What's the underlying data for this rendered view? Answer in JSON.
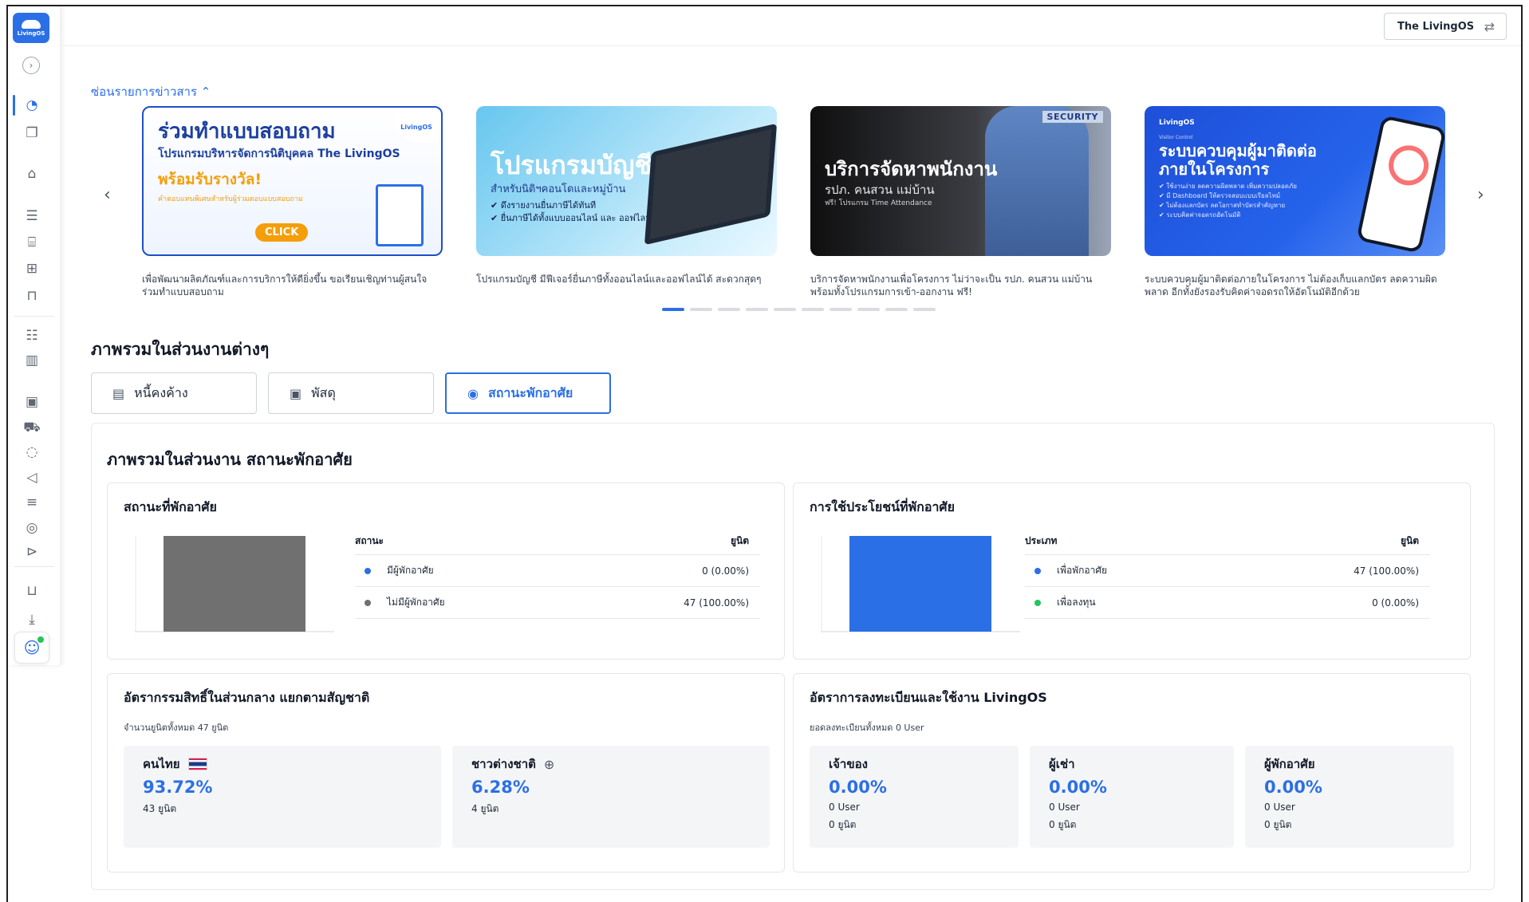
{
  "logo": {
    "text": "LivingOS"
  },
  "sidebar": {
    "expand_glyph": "›",
    "icons": [
      {
        "name": "dashboard-icon",
        "glyph": "◔",
        "active": true
      },
      {
        "name": "documents-icon",
        "glyph": "❐"
      },
      {
        "name": "home-icon",
        "glyph": "⌂"
      },
      {
        "name": "database-icon",
        "glyph": "☰"
      },
      {
        "name": "bank-icon",
        "glyph": "⌸"
      },
      {
        "name": "grid-icon",
        "glyph": "⊞"
      },
      {
        "name": "chair-icon",
        "glyph": "⊓"
      },
      {
        "name": "chat-board-icon",
        "glyph": "☷"
      },
      {
        "name": "building-icon",
        "glyph": "▥"
      },
      {
        "name": "parcel-icon",
        "glyph": "▣"
      },
      {
        "name": "truck-icon",
        "glyph": "⛟"
      },
      {
        "name": "message-icon",
        "glyph": "◌"
      },
      {
        "name": "megaphone-icon",
        "glyph": "◁"
      },
      {
        "name": "facility-icon",
        "glyph": "≡"
      },
      {
        "name": "support-icon",
        "glyph": "◎"
      },
      {
        "name": "cctv-icon",
        "glyph": "⊳"
      },
      {
        "name": "cart-icon",
        "glyph": "⊔"
      },
      {
        "name": "download-icon",
        "glyph": "⤓"
      }
    ],
    "bot_glyph": "☺"
  },
  "topbar": {
    "project_name": "The LivingOS",
    "switch_glyph": "⇄"
  },
  "news": {
    "toggle_label": "ซ่อนรายการข่าวสาร ⌃",
    "prev_glyph": "‹",
    "next_glyph": "›",
    "banners": [
      {
        "title": "ร่วมทำแบบสอบถาม",
        "subtitle": "โปรแกรมบริหารจัดการนิติบุคคล The LivingOS",
        "highlight": "พร้อมรับรางวัล!",
        "note": "คำตอบแทนพิเศษสำหรับผู้ร่วมตอบแบบสอบถาม",
        "button": "CLICK",
        "badge": "LivingOS",
        "caption": "เพื่อพัฒนาผลิตภัณฑ์และการบริการให้ดียิ่งขึ้น ขอเรียนเชิญท่านผู้สนใจ ร่วมทำแบบสอบถาม"
      },
      {
        "title": "โปรแกรมบัญชี",
        "subtitle": "สำหรับนิติฯคอนโดและหมู่บ้าน",
        "bullets": "✔ ดึงรายงานยื่นภาษีได้ทันที\n✔ ยื่นภาษีได้ทั้งแบบออนไลน์ และ ออฟไลน์",
        "caption": "โปรแกรมบัญชี มีฟีเจอร์ยื่นภาษีทั้งออนไลน์และออฟไลน์ได้ สะดวกสุดๆ"
      },
      {
        "tag": "SECURITY",
        "title": "บริการจัดหาพนักงาน",
        "subtitle": "รปภ. คนสวน แม่บ้าน",
        "note": "ฟรี! โปรแกรม Time Attendance",
        "caption": "บริการจัดหาพนักงานเพื่อโครงการ ไม่ว่าจะเป็น รปภ. คนสวน แม่บ้าน พร้อมทั้งโปรแกรมการเข้า-ออกงาน ฟรี!"
      },
      {
        "brand": "LivingOS",
        "eyebrow": "Visitor Control",
        "title": "ระบบควบคุมผู้มาติดต่อ ภายในโครงการ",
        "bullets": "✔ ใช้งานง่าย ลดความผิดพลาด เพิ่มความปลอดภัย\n✔ มี Dashboard ให้ตรวจสอบแบบเรียลไทม์\n✔ ไม่ต้องแลกบัตร ลดโอกาสทำบัตรสำคัญหาย\n✔ ระบบคิดค่าจอดรถอัตโนมัติ",
        "caption": "ระบบควบคุมผู้มาติดต่อภายในโครงการ ไม่ต้องเก็บแลกบัตร ลดความผิดพลาด อีกทั้งยังรองรับคิดค่าจอดรถให้อัตโนมัติอีกด้วย"
      }
    ],
    "pagination_count": 10,
    "pagination_active": 0
  },
  "overview": {
    "title": "ภาพรวมในส่วนงานต่างๆ",
    "tabs": [
      {
        "label": "หนี้คงค้าง",
        "glyph": "▤",
        "active": false
      },
      {
        "label": "พัสดุ",
        "glyph": "▣",
        "active": false
      },
      {
        "label": "สถานะพักอาศัย",
        "glyph": "◉",
        "active": true
      }
    ]
  },
  "residence": {
    "panel_title": "ภาพรวมในส่วนงาน สถานะพักอาศัย",
    "status_card": {
      "title": "สถานะที่พักอาศัย",
      "col_type": "สถานะ",
      "col_unit": "ยูนิต",
      "rows": [
        {
          "label": "มีผู้พักอาศัย",
          "value": "0 (0.00%)",
          "color": "#2b6fe6"
        },
        {
          "label": "ไม่มีผู้พักอาศัย",
          "value": "47 (100.00%)",
          "color": "#707070"
        }
      ]
    },
    "usage_card": {
      "title": "การใช้ประโยชน์ที่พักอาศัย",
      "col_type": "ประเภท",
      "col_unit": "ยูนิต",
      "rows": [
        {
          "label": "เพื่อพักอาศัย",
          "value": "47 (100.00%)",
          "color": "#2b6fe6"
        },
        {
          "label": "เพื่อลงทุน",
          "value": "0 (0.00%)",
          "color": "#22c55e"
        }
      ]
    },
    "ownership_card": {
      "title": "อัตรากรรมสิทธิ์ในส่วนกลาง แยกตามสัญชาติ",
      "subtitle": "จำนวนยูนิตทั้งหมด 47 ยูนิต",
      "stats": [
        {
          "label": "คนไทย",
          "pct": "93.72%",
          "units": "43 ยูนิต"
        },
        {
          "label": "ชาวต่างชาติ",
          "pct": "6.28%",
          "units": "4 ยูนิต"
        }
      ]
    },
    "registration_card": {
      "title": "อัตราการลงทะเบียนและใช้งาน LivingOS",
      "subtitle": "ยอดลงทะเบียนทั้งหมด 0 User",
      "stats": [
        {
          "label": "เจ้าของ",
          "pct": "0.00%",
          "users": "0 User",
          "units": "0 ยูนิต"
        },
        {
          "label": "ผู้เช่า",
          "pct": "0.00%",
          "users": "0 User",
          "units": "0 ยูนิต"
        },
        {
          "label": "ผู้พักอาศัย",
          "pct": "0.00%",
          "users": "0 User",
          "units": "0 ยูนิต"
        }
      ]
    }
  },
  "chart_data": [
    {
      "type": "bar",
      "title": "สถานะที่พักอาศัย",
      "categories": [
        "มีผู้พักอาศัย",
        "ไม่มีผู้พักอาศัย"
      ],
      "values": [
        0,
        47
      ],
      "colors": [
        "#2b6fe6",
        "#707070"
      ]
    },
    {
      "type": "bar",
      "title": "การใช้ประโยชน์ที่พักอาศัย",
      "categories": [
        "เพื่อพักอาศัย",
        "เพื่อลงทุน"
      ],
      "values": [
        47,
        0
      ],
      "colors": [
        "#2b6fe6",
        "#22c55e"
      ]
    }
  ]
}
